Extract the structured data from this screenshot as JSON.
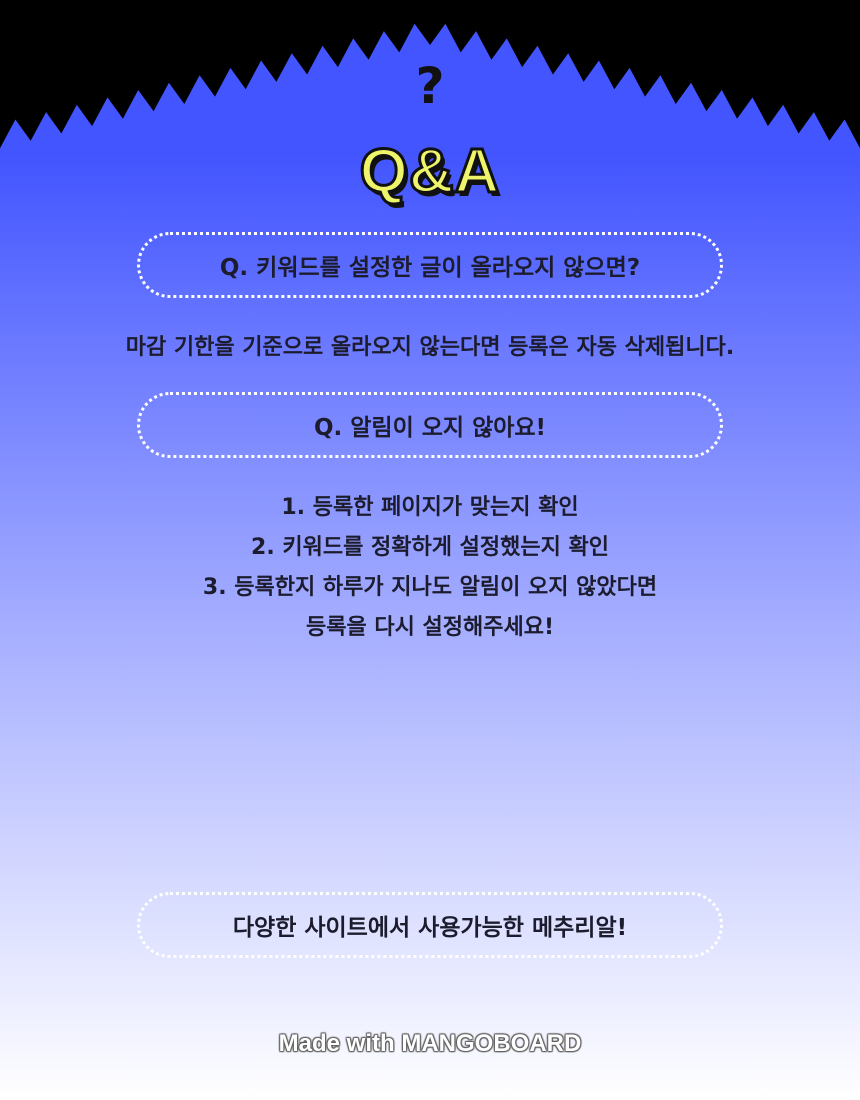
{
  "header": {
    "icon_glyph": "?",
    "title": "Q&A"
  },
  "faq": [
    {
      "question": "Q. 키워드를 설정한 글이 올라오지 않으면?",
      "answer_lines": [
        "마감 기한을 기준으로 올라오지 않는다면 등록은 자동 삭제됩니다."
      ]
    },
    {
      "question": "Q. 알림이 오지 않아요!",
      "answer_lines": [
        "1. 등록한 페이지가 맞는지 확인",
        "2. 키워드를 정확하게 설정했는지 확인",
        "3. 등록한지 하루가 지나도 알림이 오지 않았다면",
        "등록을 다시 설정해주세요!"
      ]
    }
  ],
  "promo": {
    "label": "다양한 사이트에서 사용가능한 메추리알!"
  },
  "footer": {
    "credit": "Made with MANGOBOARD"
  },
  "colors": {
    "top_blue": "#4255ff",
    "bottom_white": "#ffffff",
    "title_yellow": "#eef56a",
    "text_dark": "#1c1c2e",
    "outer_black": "#000000"
  }
}
